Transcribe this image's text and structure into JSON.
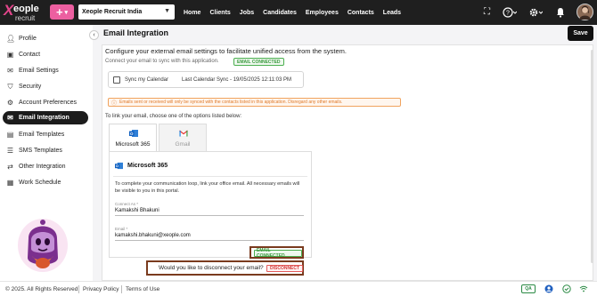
{
  "brand": {
    "logo_x": "X",
    "logo_name": "eople",
    "logo_sub": "recruit"
  },
  "header": {
    "add_label": "+",
    "org_select": "Xeople Recruit India",
    "nav": [
      "Home",
      "Clients",
      "Jobs",
      "Candidates",
      "Employees",
      "Contacts",
      "Leads"
    ],
    "icons": [
      "fullscreen-icon",
      "help-icon",
      "settings-icon",
      "bell-icon",
      "avatar"
    ]
  },
  "sidebar": {
    "items": [
      {
        "label": "Profile",
        "icon": "user-icon"
      },
      {
        "label": "Contact",
        "icon": "contact-icon"
      },
      {
        "label": "Email Settings",
        "icon": "mail-icon"
      },
      {
        "label": "Security",
        "icon": "shield-icon"
      },
      {
        "label": "Account Preferences",
        "icon": "account-icon"
      },
      {
        "label": "Email Integration",
        "icon": "mail-icon",
        "active": true
      },
      {
        "label": "Email Templates",
        "icon": "template-icon"
      },
      {
        "label": "SMS Templates",
        "icon": "sms-icon"
      },
      {
        "label": "Other Integration",
        "icon": "integration-icon"
      },
      {
        "label": "Work Schedule",
        "icon": "calendar-icon"
      }
    ]
  },
  "page": {
    "title": "Email Integration",
    "save_label": "Save",
    "heading": "Configure your external email settings to facilitate unified access from the system.",
    "connect_text": "Connect your email to sync with this application.",
    "email_status": "EMAIL CONNECTED",
    "sync_label": "Sync my Calendar",
    "last_sync": "Last Calendar Sync - 19/05/2025 12:11:03 PM",
    "warning": "Emails sent or received will only be synced with the contacts listed in this application. Disregard any other emails.",
    "choose_text": "To link your email, choose one of the options listed below:",
    "tabs": [
      {
        "label": "Microsoft 365"
      },
      {
        "label": "Gmail"
      }
    ],
    "panel": {
      "title": "Microsoft 365",
      "description": "To complete your communication loop, link your office email. All necessary emails will be visible to you in this portal.",
      "connect_as_label": "Connect As *",
      "connect_as_value": "Kamakshi Bhakuni",
      "email_label": "Email *",
      "email_value": "kamakshi.bhakuni@xeople.com"
    },
    "connected_badge": "EMAIL CONNECTED",
    "disconnect_question": "Would you like to disconnect your email?",
    "disconnect_label": "DISCONNECT"
  },
  "footer": {
    "copyright": "© 2025. All Rights Reserved",
    "privacy": "Privacy Policy",
    "terms": "Terms of Use",
    "qa": "QA"
  },
  "colors": {
    "accent_pink": "#ec5fa0",
    "topbar": "#1f1f1f",
    "active_nav": "#1c1c1c",
    "success": "#3a9a3e",
    "danger": "#d43b3b",
    "warning": "#e07a2a",
    "highlight_border": "#7a3b1e"
  }
}
